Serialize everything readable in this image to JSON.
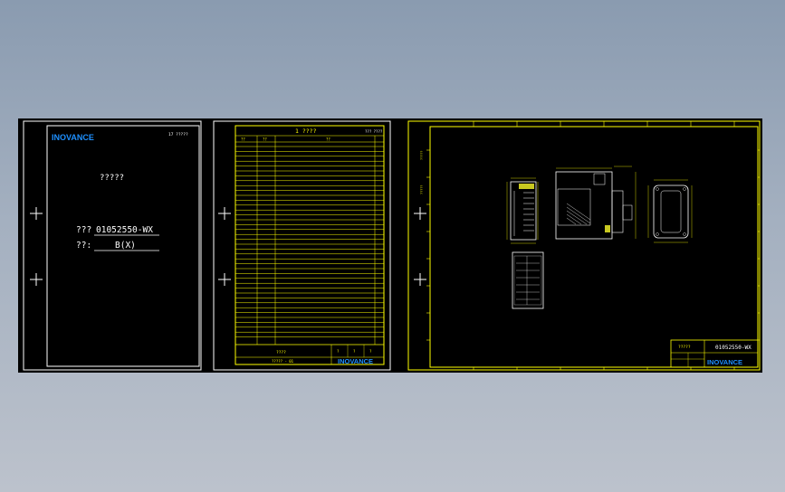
{
  "brand": {
    "logo_text": "INOVANCE",
    "logo_color": "#1e90ff"
  },
  "colors": {
    "background_top": "#8a9bb0",
    "background_bottom": "#bcc2cc",
    "canvas": "#000000",
    "frame": "#ffffff",
    "drawing": "#ffff00",
    "cabinet_lines": "#ffffff"
  },
  "sheet1": {
    "page_code": "17  ?????",
    "title": "?????",
    "model_label": "???",
    "model_value": "01052550-WX",
    "version_label": "??:",
    "version_value": "B(X)"
  },
  "sheet2": {
    "title": "1  ????",
    "top_right_code": "???  ????",
    "col_headers": [
      "??",
      "??",
      "??"
    ],
    "footer_label": "????",
    "footer_code": "????? - 01",
    "footer_marks": [
      "?",
      "?",
      "?"
    ]
  },
  "sheet3": {
    "left_tags": [
      "?????",
      "?????"
    ],
    "title_block_label": "?????",
    "title_block_model": "01052550-WX"
  }
}
